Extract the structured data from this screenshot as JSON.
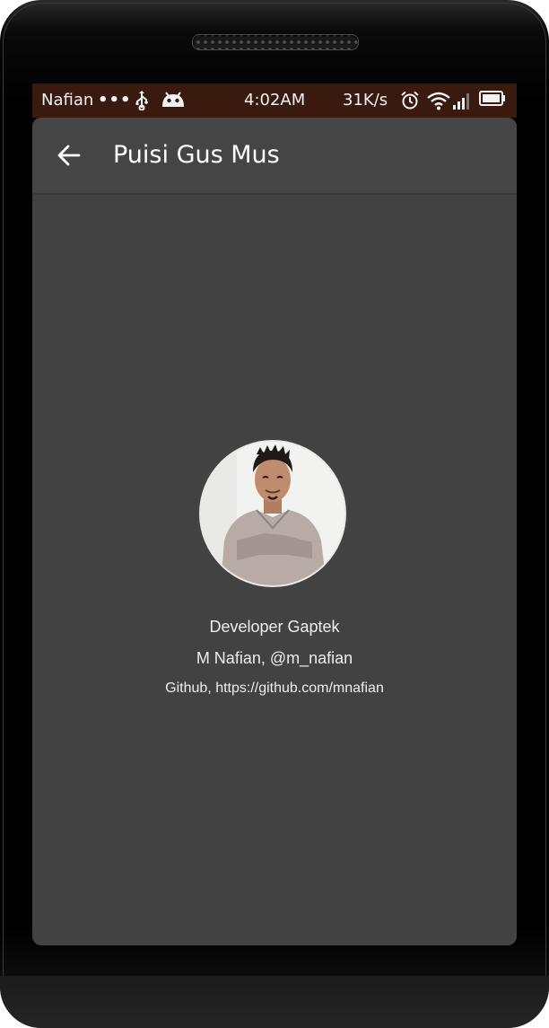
{
  "statusbar": {
    "carrier": "Nafian",
    "dots": "•••",
    "time": "4:02AM",
    "net_speed": "31K/s",
    "icons": [
      "usb-icon",
      "android-icon",
      "alarm-icon",
      "wifi-icon",
      "signal-icon",
      "battery-icon"
    ]
  },
  "appbar": {
    "title": "Puisi Gus Mus",
    "back_icon": "back-arrow-icon"
  },
  "developer": {
    "title": "Developer Gaptek",
    "name": "M Nafian, @m_nafian",
    "github": "Github, https://github.com/mnafian",
    "avatar": "developer-photo"
  },
  "colors": {
    "statusbar_bg": "#3a1a0f",
    "app_bg": "#424242",
    "appbar_bg": "#454545",
    "text": "#eeeeee"
  }
}
